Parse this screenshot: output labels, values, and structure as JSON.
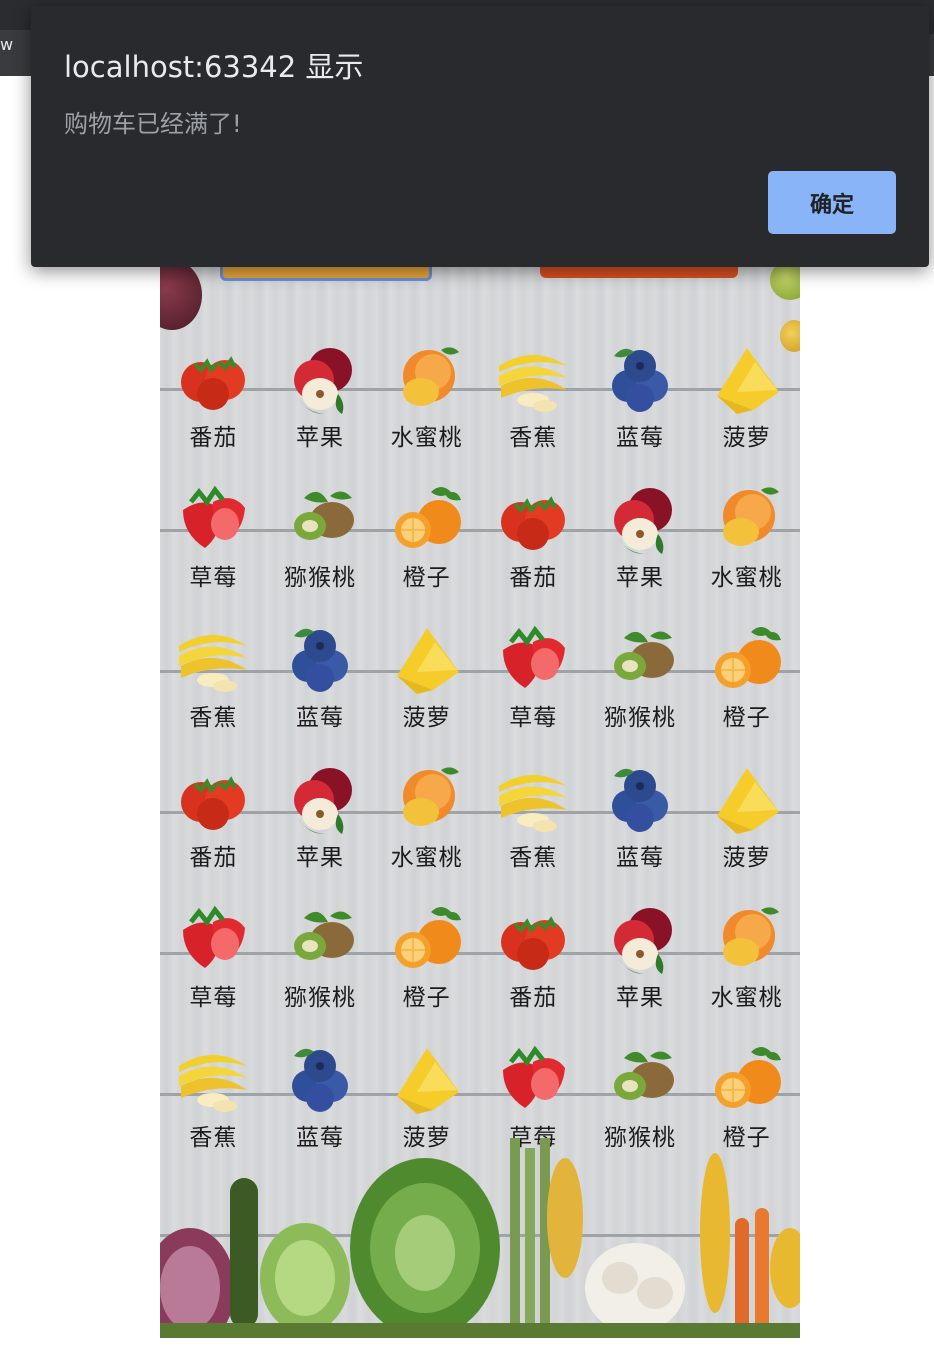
{
  "browser": {
    "tab_fragment": "w"
  },
  "dialog": {
    "title": "localhost:63342 显示",
    "message": "购物车已经满了!",
    "ok_label": "确定",
    "accent_color": "#8ab4f8"
  },
  "grid": {
    "rows": [
      [
        {
          "name": "番茄",
          "icon": "tomato"
        },
        {
          "name": "苹果",
          "icon": "apple"
        },
        {
          "name": "水蜜桃",
          "icon": "peach"
        },
        {
          "name": "香蕉",
          "icon": "banana"
        },
        {
          "name": "蓝莓",
          "icon": "blueberry"
        },
        {
          "name": "菠萝",
          "icon": "pineapple"
        }
      ],
      [
        {
          "name": "草莓",
          "icon": "strawberry"
        },
        {
          "name": "猕猴桃",
          "icon": "kiwi"
        },
        {
          "name": "橙子",
          "icon": "orange"
        },
        {
          "name": "番茄",
          "icon": "tomato"
        },
        {
          "name": "苹果",
          "icon": "apple"
        },
        {
          "name": "水蜜桃",
          "icon": "peach"
        }
      ],
      [
        {
          "name": "香蕉",
          "icon": "banana"
        },
        {
          "name": "蓝莓",
          "icon": "blueberry"
        },
        {
          "name": "菠萝",
          "icon": "pineapple"
        },
        {
          "name": "草莓",
          "icon": "strawberry"
        },
        {
          "name": "猕猴桃",
          "icon": "kiwi"
        },
        {
          "name": "橙子",
          "icon": "orange"
        }
      ],
      [
        {
          "name": "番茄",
          "icon": "tomato"
        },
        {
          "name": "苹果",
          "icon": "apple"
        },
        {
          "name": "水蜜桃",
          "icon": "peach"
        },
        {
          "name": "香蕉",
          "icon": "banana"
        },
        {
          "name": "蓝莓",
          "icon": "blueberry"
        },
        {
          "name": "菠萝",
          "icon": "pineapple"
        }
      ],
      [
        {
          "name": "草莓",
          "icon": "strawberry"
        },
        {
          "name": "猕猴桃",
          "icon": "kiwi"
        },
        {
          "name": "橙子",
          "icon": "orange"
        },
        {
          "name": "番茄",
          "icon": "tomato"
        },
        {
          "name": "苹果",
          "icon": "apple"
        },
        {
          "name": "水蜜桃",
          "icon": "peach"
        }
      ],
      [
        {
          "name": "香蕉",
          "icon": "banana"
        },
        {
          "name": "蓝莓",
          "icon": "blueberry"
        },
        {
          "name": "菠萝",
          "icon": "pineapple"
        },
        {
          "name": "草莓",
          "icon": "strawberry"
        },
        {
          "name": "猕猴桃",
          "icon": "kiwi"
        },
        {
          "name": "橙子",
          "icon": "orange"
        }
      ]
    ]
  },
  "top_buttons": {
    "left_color": "#e8a53a",
    "right_color": "#d94f22"
  }
}
